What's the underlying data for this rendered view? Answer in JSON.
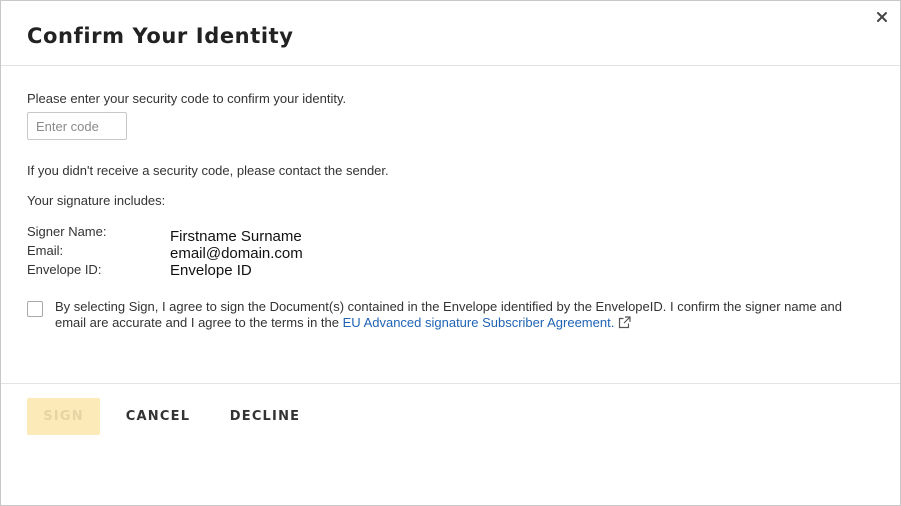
{
  "dialog": {
    "title": "Confirm Your Identity",
    "close_icon": "close-icon"
  },
  "security": {
    "prompt": "Please enter your security code to confirm your identity.",
    "placeholder": "Enter code",
    "value": "",
    "no_code_text": "If you didn't receive a security code, please contact the sender."
  },
  "signature": {
    "heading": "Your signature includes:",
    "fields": [
      {
        "label": "Signer Name:",
        "value": "Firstname Surname"
      },
      {
        "label": "Email:",
        "value": "email@domain.com"
      },
      {
        "label": "Envelope ID:",
        "value": "Envelope ID"
      }
    ]
  },
  "consent": {
    "checked": false,
    "text": "By selecting Sign, I agree to sign the Document(s) contained in the Envelope identified by the EnvelopeID. I confirm the signer name and email are accurate and I agree to the terms in the ",
    "link_text": "EU Advanced signature Subscriber Agreement.",
    "link_icon": "external-link-icon"
  },
  "actions": {
    "sign_label": "SIGN",
    "cancel_label": "CANCEL",
    "decline_label": "DECLINE"
  },
  "colors": {
    "link": "#1f63b5",
    "sign_disabled_bg": "#fdeab9",
    "sign_disabled_text": "#e6d4a4"
  }
}
